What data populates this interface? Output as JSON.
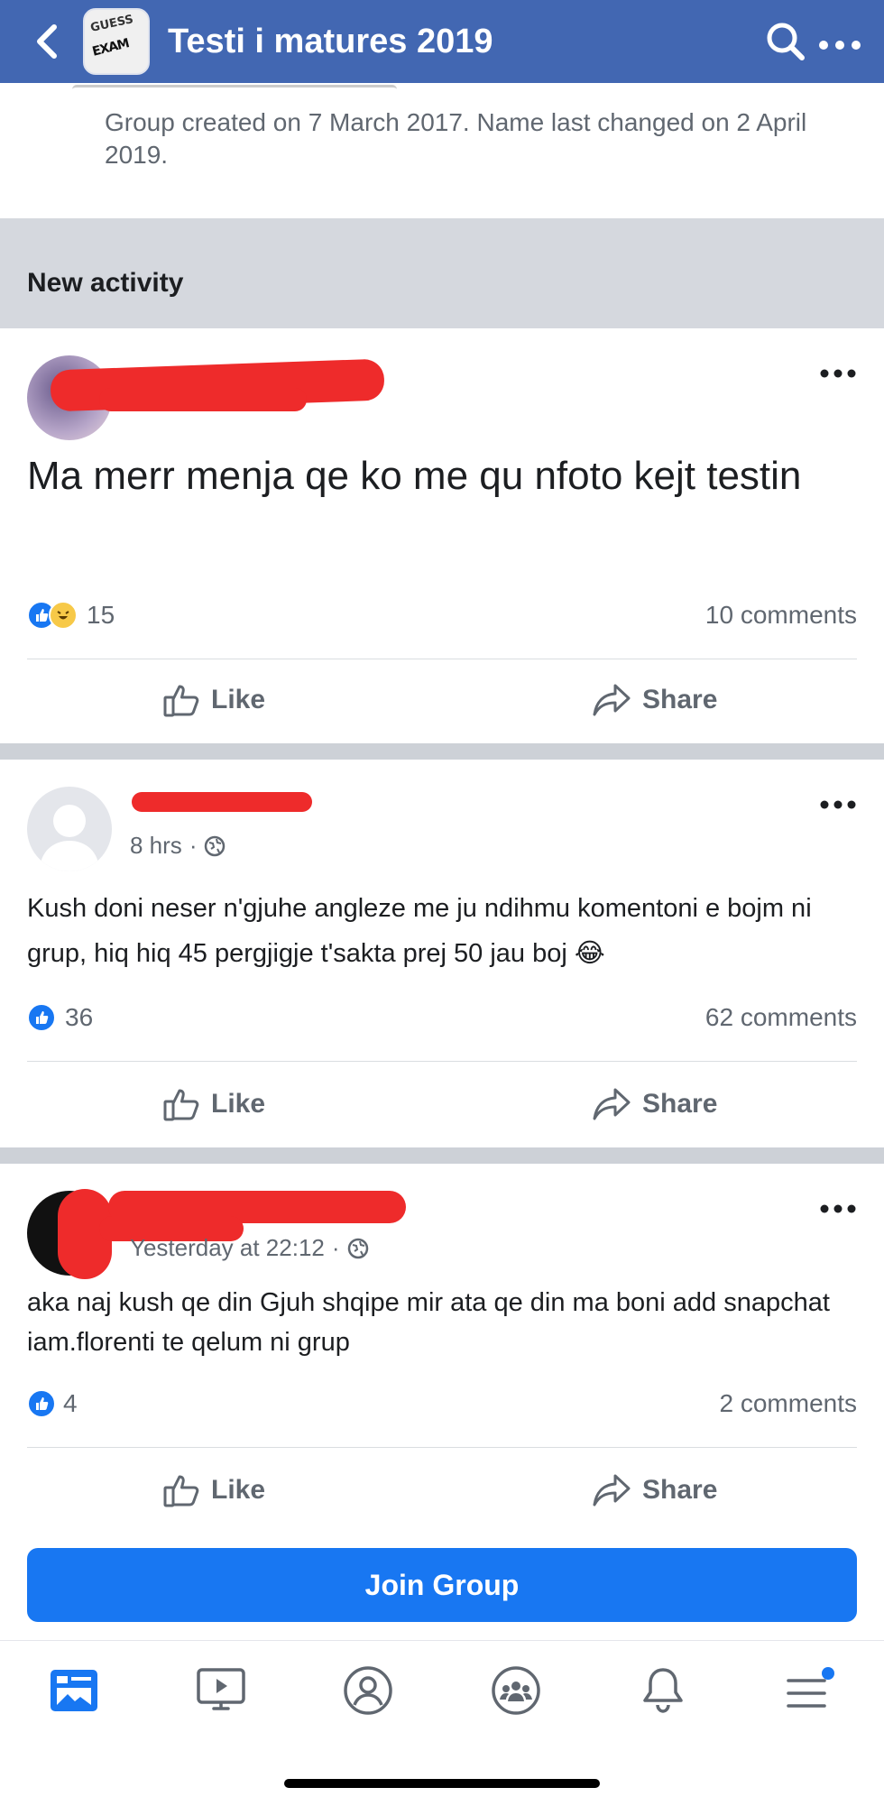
{
  "header": {
    "title": "Testi i matures 2019",
    "thumb_text_1": "GUESS",
    "thumb_text_2": "EXAM"
  },
  "group_info": {
    "text": "Group created on 7 March 2017. Name last changed on 2 April 2019."
  },
  "section": {
    "title": "New activity"
  },
  "posts": [
    {
      "time": "",
      "text": "Ma merr menja qe ko me qu nfoto kejt testin",
      "reaction_count": "15",
      "comments": "10 comments"
    },
    {
      "time": "8 hrs",
      "text": "Kush doni neser n'gjuhe angleze me ju ndihmu komentoni e bojm ni grup, hiq hiq 45 pergjigje t'sakta prej 50 jau boj 😂",
      "reaction_count": "36",
      "comments": "62 comments"
    },
    {
      "time": "Yesterday at 22:12",
      "text": "aka naj kush qe din Gjuh shqipe mir ata qe din ma boni add snapchat iam.florenti te qelum ni grup",
      "reaction_count": "4",
      "comments": "2 comments"
    }
  ],
  "actions": {
    "like": "Like",
    "share": "Share"
  },
  "join_button": "Join Group",
  "bottom_nav": [
    "feed-icon",
    "watch-icon",
    "profile-icon",
    "groups-icon",
    "notifications-icon",
    "menu-icon"
  ],
  "colors": {
    "brand": "#4267b2",
    "primary": "#1877f2",
    "redaction": "#ee2b2b"
  }
}
